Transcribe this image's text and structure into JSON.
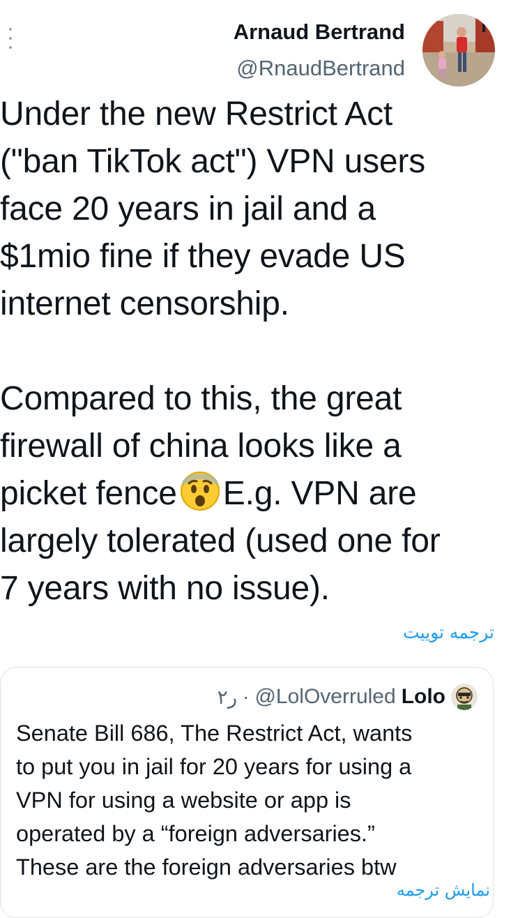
{
  "tweet": {
    "author_name": "Arnaud Bertrand",
    "author_handle": "@RnaudBertrand",
    "text_part1": "Under the new Restrict Act\n(\"ban TikTok act\") VPN users\nface 20 years in jail and a\n$1mio fine if they evade US\ninternet censorship.\n\nCompared to this, the great\nfirewall of china looks like a\npicket fence",
    "text_part2": "E.g. VPN are\nlargely tolerated (used one for\n7 years with no issue).",
    "emoji": "anguished-face-emoji",
    "translate_label": "ترجمه توییت"
  },
  "quoted_tweet": {
    "author_name": "Lolo",
    "author_handle": "@LolOverruled",
    "separator": "·",
    "timestamp": "۲ر",
    "text": "Senate Bill 686, The Restrict Act, wants\nto put you in jail for 20 years for using a\nVPN for using a website or app is\noperated by a “foreign adversaries.”\nThese are the foreign adversaries btw",
    "translate_label_partial": "نمایش ترجمه"
  },
  "colors": {
    "text": "#0f1419",
    "secondary": "#536471",
    "link": "#1d9bf0",
    "border": "#dfe4e8"
  }
}
